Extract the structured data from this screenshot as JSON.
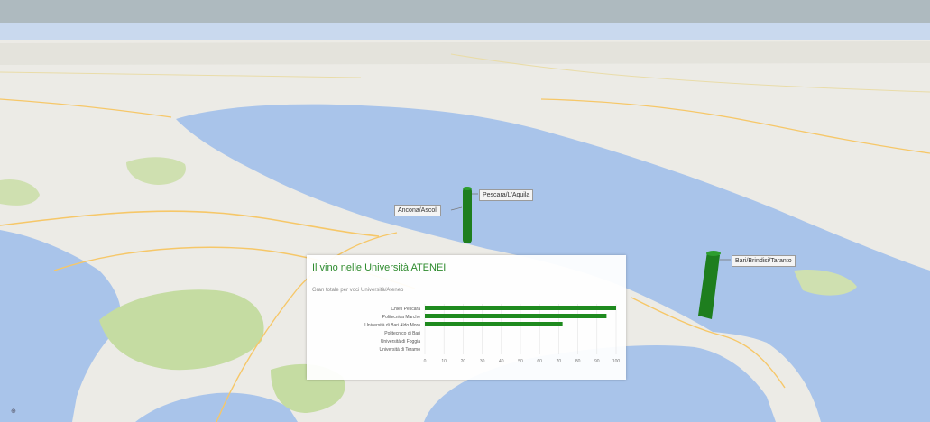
{
  "map": {
    "style": "3D tilted road map",
    "colors": {
      "sea": "#a9c4ea",
      "land": "#ecebe6",
      "park": "#c5dca2",
      "road": "#f6c768",
      "sky": "#aebabf"
    }
  },
  "markers": [
    {
      "label": "Pescara/L'Aquila",
      "level": 0.55,
      "color": "#1e7e1e"
    },
    {
      "label": "Bari/Brindisi",
      "level": 0.72,
      "color": "#1e7e1e"
    }
  ],
  "callouts": {
    "pescara_right": "Pescara/L'Aquila",
    "pescara_left": "Ancona/Ascoli",
    "bari": "Bari/Brindisi/Taranto"
  },
  "panel": {
    "title": "Il vino nelle Università ATENEI",
    "subtitle": "Gran totale per voci Università/Ateneo"
  },
  "chart_data": {
    "type": "bar",
    "orientation": "horizontal",
    "categories": [
      "Chieti Pescara",
      "Politecnica Marche",
      "Università di Bari Aldo Moro",
      "Politecnico di Bari",
      "Università di Foggia",
      "Università di Teramo"
    ],
    "values": [
      100,
      95,
      72,
      0,
      0,
      0
    ],
    "xlim": [
      0,
      100
    ],
    "xticks": [
      0,
      10,
      20,
      30,
      40,
      50,
      60,
      70,
      80,
      90,
      100
    ],
    "grid": true,
    "bar_color": "#1e8a1e"
  },
  "footer": {
    "zoom_label": "⊕"
  }
}
